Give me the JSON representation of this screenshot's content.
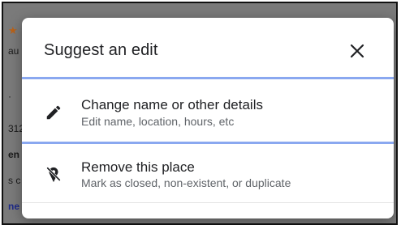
{
  "dialog": {
    "title": "Suggest an edit",
    "close_icon": "close-icon",
    "options": [
      {
        "icon": "pencil-icon",
        "title": "Change name or other details",
        "subtitle": "Edit name, location, hours, etc"
      },
      {
        "icon": "remove-place-icon",
        "title": "Remove this place",
        "subtitle": "Mark as closed, non-existent, or duplicate"
      }
    ]
  },
  "background_fragments": [
    "★",
    "au",
    "·",
    "312",
    "en",
    "s c",
    "ne"
  ],
  "colors": {
    "overlay": "#7a7a7a",
    "dialog_bg": "#ffffff",
    "highlight_border": "#8aa8f0",
    "title_text": "#202124",
    "subtitle_text": "#5f6368"
  }
}
